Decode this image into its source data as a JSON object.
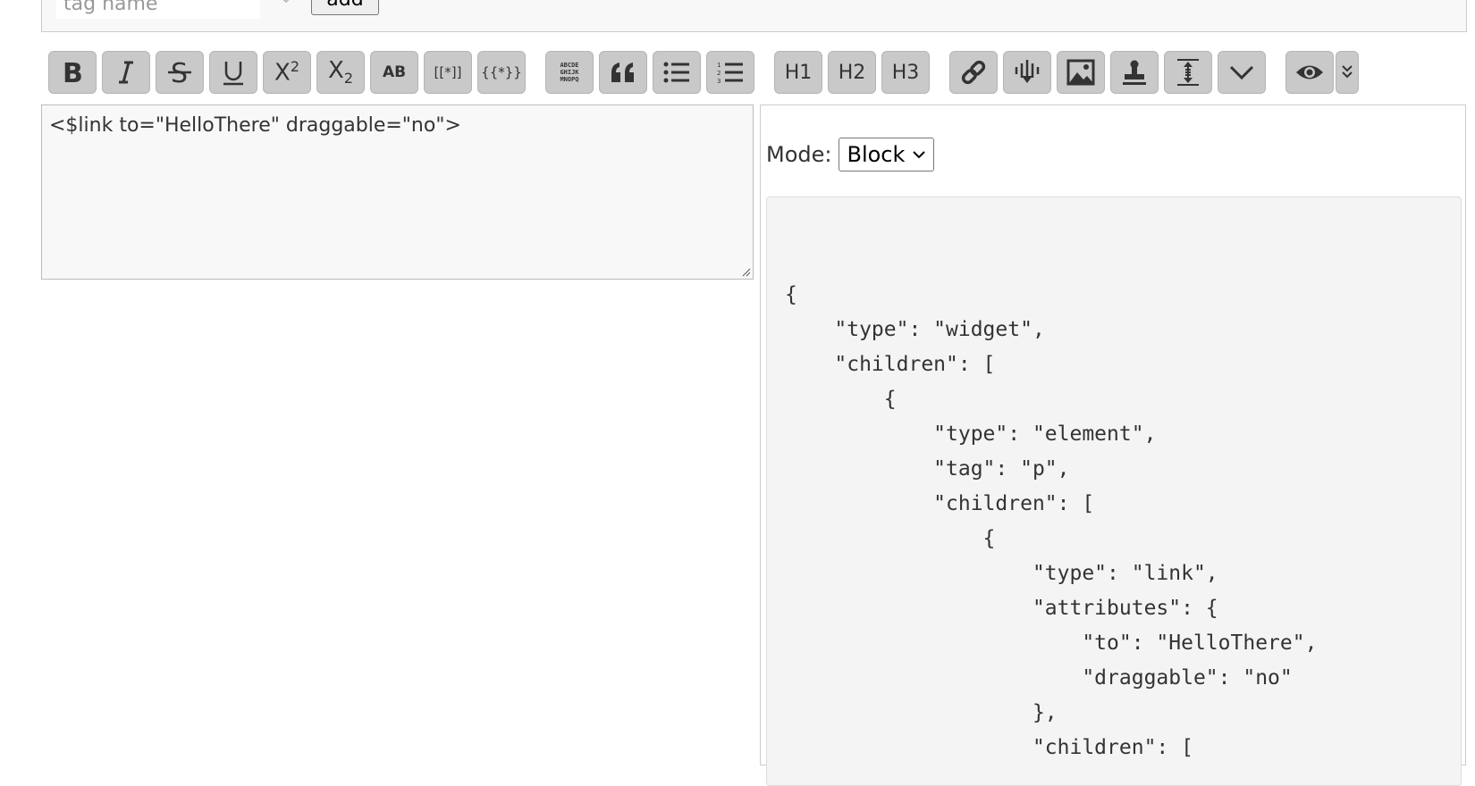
{
  "tag_bar": {
    "placeholder": "tag name",
    "add_label": "add"
  },
  "toolbar": {
    "superscript_label": "X",
    "superscript_sup": "2",
    "subscript_label": "X",
    "subscript_sub": "2",
    "smallcaps_label": "AB",
    "transclude_label": "[[*]]",
    "macro_label": "{{*}}",
    "mono_line1": "ABCDE",
    "mono_line2": "GHIJK",
    "mono_line3": "MNOPQ",
    "h1_label": "H1",
    "h2_label": "H2",
    "h3_label": "H3"
  },
  "editor": {
    "text": "<$link to=\"HelloThere\" draggable=\"no\">"
  },
  "preview": {
    "mode_label": "Mode:",
    "mode_value": "Block",
    "code_lines": [
      "{",
      "    \"type\": \"widget\",",
      "    \"children\": [",
      "        {",
      "            \"type\": \"element\",",
      "            \"tag\": \"p\",",
      "            \"children\": [",
      "                {",
      "                    \"type\": \"link\",",
      "                    \"attributes\": {",
      "                        \"to\": \"HelloThere\",",
      "                        \"draggable\": \"no\"",
      "                    },",
      "                    \"children\": ["
    ]
  }
}
